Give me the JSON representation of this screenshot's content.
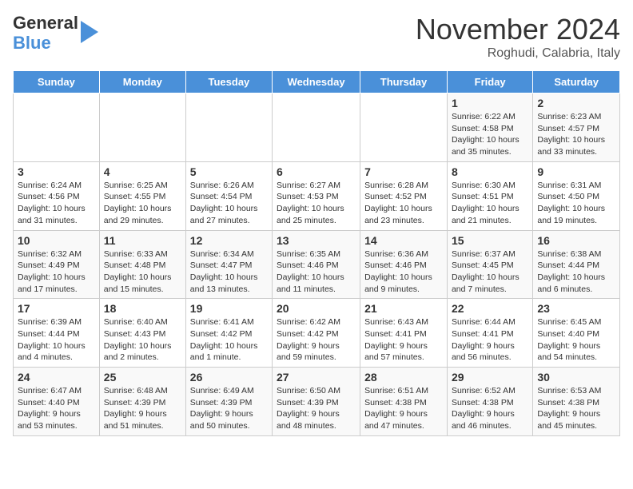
{
  "header": {
    "logo_line1": "General",
    "logo_line2": "Blue",
    "month": "November 2024",
    "location": "Roghudi, Calabria, Italy"
  },
  "days_of_week": [
    "Sunday",
    "Monday",
    "Tuesday",
    "Wednesday",
    "Thursday",
    "Friday",
    "Saturday"
  ],
  "weeks": [
    [
      {
        "day": "",
        "info": ""
      },
      {
        "day": "",
        "info": ""
      },
      {
        "day": "",
        "info": ""
      },
      {
        "day": "",
        "info": ""
      },
      {
        "day": "",
        "info": ""
      },
      {
        "day": "1",
        "info": "Sunrise: 6:22 AM\nSunset: 4:58 PM\nDaylight: 10 hours and 35 minutes."
      },
      {
        "day": "2",
        "info": "Sunrise: 6:23 AM\nSunset: 4:57 PM\nDaylight: 10 hours and 33 minutes."
      }
    ],
    [
      {
        "day": "3",
        "info": "Sunrise: 6:24 AM\nSunset: 4:56 PM\nDaylight: 10 hours and 31 minutes."
      },
      {
        "day": "4",
        "info": "Sunrise: 6:25 AM\nSunset: 4:55 PM\nDaylight: 10 hours and 29 minutes."
      },
      {
        "day": "5",
        "info": "Sunrise: 6:26 AM\nSunset: 4:54 PM\nDaylight: 10 hours and 27 minutes."
      },
      {
        "day": "6",
        "info": "Sunrise: 6:27 AM\nSunset: 4:53 PM\nDaylight: 10 hours and 25 minutes."
      },
      {
        "day": "7",
        "info": "Sunrise: 6:28 AM\nSunset: 4:52 PM\nDaylight: 10 hours and 23 minutes."
      },
      {
        "day": "8",
        "info": "Sunrise: 6:30 AM\nSunset: 4:51 PM\nDaylight: 10 hours and 21 minutes."
      },
      {
        "day": "9",
        "info": "Sunrise: 6:31 AM\nSunset: 4:50 PM\nDaylight: 10 hours and 19 minutes."
      }
    ],
    [
      {
        "day": "10",
        "info": "Sunrise: 6:32 AM\nSunset: 4:49 PM\nDaylight: 10 hours and 17 minutes."
      },
      {
        "day": "11",
        "info": "Sunrise: 6:33 AM\nSunset: 4:48 PM\nDaylight: 10 hours and 15 minutes."
      },
      {
        "day": "12",
        "info": "Sunrise: 6:34 AM\nSunset: 4:47 PM\nDaylight: 10 hours and 13 minutes."
      },
      {
        "day": "13",
        "info": "Sunrise: 6:35 AM\nSunset: 4:46 PM\nDaylight: 10 hours and 11 minutes."
      },
      {
        "day": "14",
        "info": "Sunrise: 6:36 AM\nSunset: 4:46 PM\nDaylight: 10 hours and 9 minutes."
      },
      {
        "day": "15",
        "info": "Sunrise: 6:37 AM\nSunset: 4:45 PM\nDaylight: 10 hours and 7 minutes."
      },
      {
        "day": "16",
        "info": "Sunrise: 6:38 AM\nSunset: 4:44 PM\nDaylight: 10 hours and 6 minutes."
      }
    ],
    [
      {
        "day": "17",
        "info": "Sunrise: 6:39 AM\nSunset: 4:44 PM\nDaylight: 10 hours and 4 minutes."
      },
      {
        "day": "18",
        "info": "Sunrise: 6:40 AM\nSunset: 4:43 PM\nDaylight: 10 hours and 2 minutes."
      },
      {
        "day": "19",
        "info": "Sunrise: 6:41 AM\nSunset: 4:42 PM\nDaylight: 10 hours and 1 minute."
      },
      {
        "day": "20",
        "info": "Sunrise: 6:42 AM\nSunset: 4:42 PM\nDaylight: 9 hours and 59 minutes."
      },
      {
        "day": "21",
        "info": "Sunrise: 6:43 AM\nSunset: 4:41 PM\nDaylight: 9 hours and 57 minutes."
      },
      {
        "day": "22",
        "info": "Sunrise: 6:44 AM\nSunset: 4:41 PM\nDaylight: 9 hours and 56 minutes."
      },
      {
        "day": "23",
        "info": "Sunrise: 6:45 AM\nSunset: 4:40 PM\nDaylight: 9 hours and 54 minutes."
      }
    ],
    [
      {
        "day": "24",
        "info": "Sunrise: 6:47 AM\nSunset: 4:40 PM\nDaylight: 9 hours and 53 minutes."
      },
      {
        "day": "25",
        "info": "Sunrise: 6:48 AM\nSunset: 4:39 PM\nDaylight: 9 hours and 51 minutes."
      },
      {
        "day": "26",
        "info": "Sunrise: 6:49 AM\nSunset: 4:39 PM\nDaylight: 9 hours and 50 minutes."
      },
      {
        "day": "27",
        "info": "Sunrise: 6:50 AM\nSunset: 4:39 PM\nDaylight: 9 hours and 48 minutes."
      },
      {
        "day": "28",
        "info": "Sunrise: 6:51 AM\nSunset: 4:38 PM\nDaylight: 9 hours and 47 minutes."
      },
      {
        "day": "29",
        "info": "Sunrise: 6:52 AM\nSunset: 4:38 PM\nDaylight: 9 hours and 46 minutes."
      },
      {
        "day": "30",
        "info": "Sunrise: 6:53 AM\nSunset: 4:38 PM\nDaylight: 9 hours and 45 minutes."
      }
    ]
  ]
}
